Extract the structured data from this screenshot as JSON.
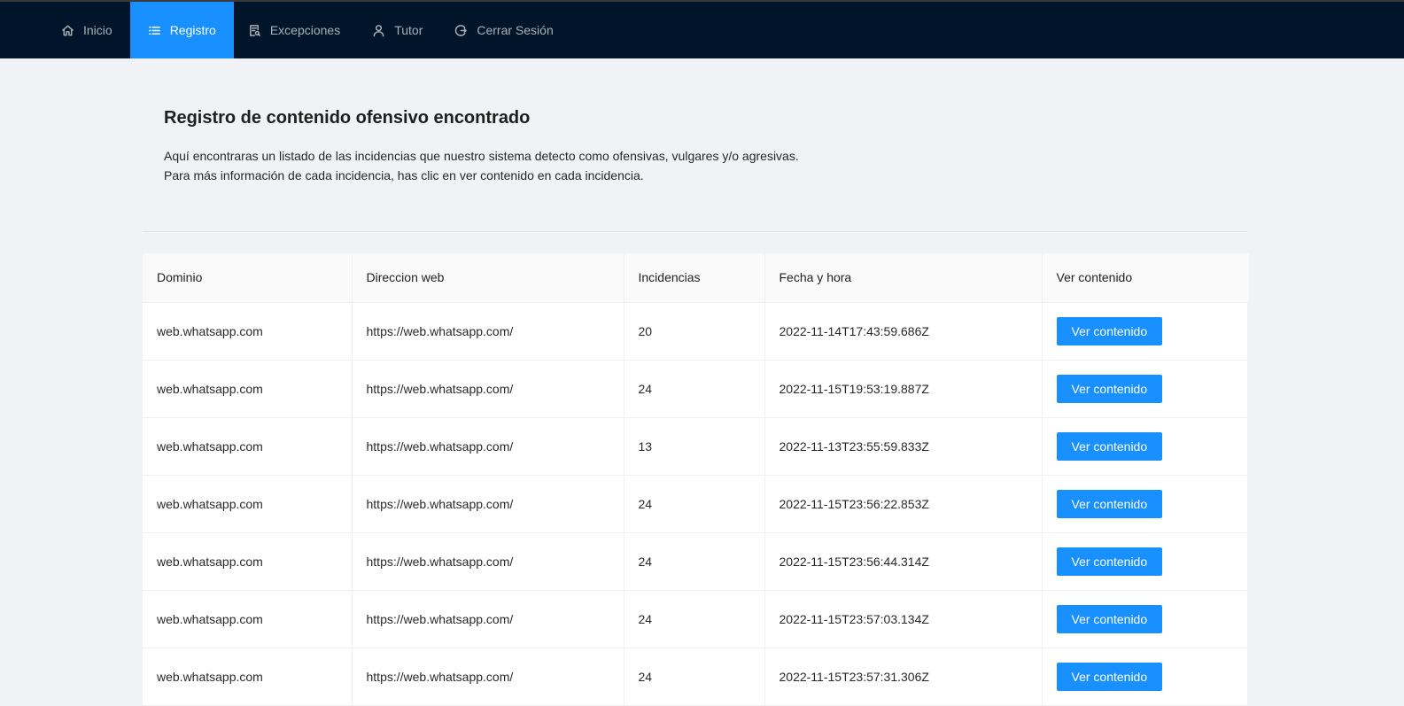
{
  "nav": {
    "items": [
      {
        "label": "Inicio",
        "icon": "home-icon"
      },
      {
        "label": "Registro",
        "icon": "list-icon"
      },
      {
        "label": "Excepciones",
        "icon": "file-search-icon"
      },
      {
        "label": "Tutor",
        "icon": "user-icon"
      },
      {
        "label": "Cerrar Sesión",
        "icon": "logout-icon"
      }
    ],
    "active": "Registro",
    "background_color": "#001529",
    "active_color": "#1890ff"
  },
  "page": {
    "title": "Registro de contenido ofensivo encontrado",
    "description_line1": "Aquí encontraras un listado de las incidencias que nuestro sistema detecto como ofensivas, vulgares y/o agresivas.",
    "description_line2": "Para más información de cada incidencia, has clic en ver contenido en cada incidencia."
  },
  "table": {
    "columns": [
      "Dominio",
      "Direccion web",
      "Incidencias",
      "Fecha y hora",
      "Ver contenido"
    ],
    "button_label": "Ver contenido",
    "rows": [
      {
        "dominio": "web.whatsapp.com",
        "url": "https://web.whatsapp.com/",
        "incidencias": "20",
        "fecha": "2022-11-14T17:43:59.686Z"
      },
      {
        "dominio": "web.whatsapp.com",
        "url": "https://web.whatsapp.com/",
        "incidencias": "24",
        "fecha": "2022-11-15T19:53:19.887Z"
      },
      {
        "dominio": "web.whatsapp.com",
        "url": "https://web.whatsapp.com/",
        "incidencias": "13",
        "fecha": "2022-11-13T23:55:59.833Z"
      },
      {
        "dominio": "web.whatsapp.com",
        "url": "https://web.whatsapp.com/",
        "incidencias": "24",
        "fecha": "2022-11-15T23:56:22.853Z"
      },
      {
        "dominio": "web.whatsapp.com",
        "url": "https://web.whatsapp.com/",
        "incidencias": "24",
        "fecha": "2022-11-15T23:56:44.314Z"
      },
      {
        "dominio": "web.whatsapp.com",
        "url": "https://web.whatsapp.com/",
        "incidencias": "24",
        "fecha": "2022-11-15T23:57:03.134Z"
      },
      {
        "dominio": "web.whatsapp.com",
        "url": "https://web.whatsapp.com/",
        "incidencias": "24",
        "fecha": "2022-11-15T23:57:31.306Z"
      }
    ]
  }
}
